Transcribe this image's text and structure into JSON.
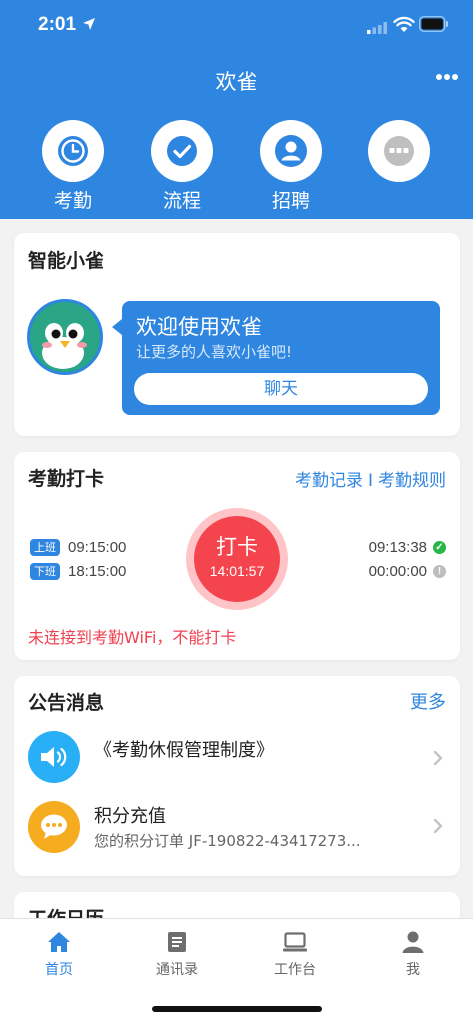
{
  "status": {
    "time": "2:01"
  },
  "nav": {
    "title": "欢雀"
  },
  "shortcuts": [
    {
      "label": "考勤",
      "icon": "clock-icon"
    },
    {
      "label": "流程",
      "icon": "check-icon"
    },
    {
      "label": "招聘",
      "icon": "person-icon"
    },
    {
      "label": "",
      "icon": "more-dots-icon"
    }
  ],
  "assistant": {
    "title": "智能小雀",
    "welcome": "欢迎使用欢雀",
    "subtitle": "让更多的人喜欢小雀吧!",
    "chat_button": "聊天"
  },
  "attendance": {
    "title": "考勤打卡",
    "link_records": "考勤记录",
    "link_separator": "I",
    "link_rules": "考勤规则",
    "on_duty_tag": "上班",
    "on_duty_time": "09:15:00",
    "off_duty_tag": "下班",
    "off_duty_time": "18:15:00",
    "punch_label": "打卡",
    "punch_clock": "14:01:57",
    "checkin_time": "09:13:38",
    "checkout_time": "00:00:00",
    "warning": "未连接到考勤WiFi，不能打卡"
  },
  "notices": {
    "title": "公告消息",
    "more": "更多",
    "items": [
      {
        "title": "《考勤休假管理制度》",
        "subtitle": "",
        "icon": "speaker-icon",
        "color": "#29aff5"
      },
      {
        "title": "积分充值",
        "subtitle": "您的积分订单 JF-190822-43417273...",
        "icon": "chat-bubble-icon",
        "color": "#f5ac1e"
      }
    ]
  },
  "calendar": {
    "title": "工作日历"
  },
  "tabs": [
    {
      "label": "首页",
      "icon": "home-icon",
      "active": true
    },
    {
      "label": "通讯录",
      "icon": "contacts-icon",
      "active": false
    },
    {
      "label": "工作台",
      "icon": "laptop-icon",
      "active": false
    },
    {
      "label": "我",
      "icon": "user-icon",
      "active": false
    }
  ],
  "colors": {
    "primary": "#2f86e0",
    "danger": "#f4454f",
    "success": "#27b548",
    "background": "#f2f2f2"
  }
}
